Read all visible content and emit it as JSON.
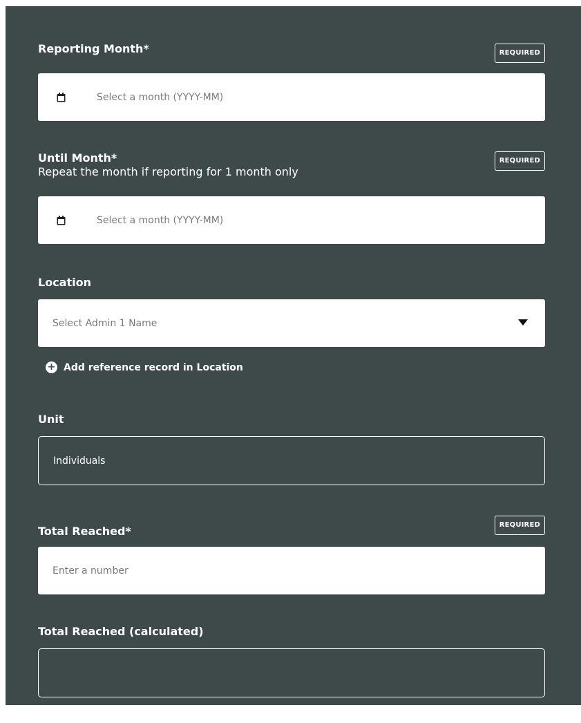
{
  "form": {
    "reporting_month": {
      "label": "Reporting Month*",
      "badge": "REQUIRED",
      "placeholder": "Select a month (YYYY-MM)",
      "icon": "calendar-icon"
    },
    "until_month": {
      "label": "Until Month*",
      "sublabel": "Repeat the month if reporting for 1 month only",
      "badge": "REQUIRED",
      "placeholder": "Select a month (YYYY-MM)",
      "icon": "calendar-icon"
    },
    "location": {
      "label": "Location",
      "placeholder": "Select Admin 1 Name",
      "icon": "caret-down-icon",
      "add_reference": "Add reference record in Location",
      "add_icon": "plus-circle-icon"
    },
    "unit": {
      "label": "Unit",
      "value": "Individuals"
    },
    "total_reached": {
      "label": "Total Reached*",
      "badge": "REQUIRED",
      "placeholder": "Enter a number"
    },
    "total_reached_calculated": {
      "label": "Total Reached (calculated)",
      "value": ""
    }
  },
  "colors": {
    "panel_background": "#3e4a4a",
    "input_background": "#ffffff",
    "placeholder_text": "#7a7a7a",
    "label_text": "#ffffff"
  }
}
